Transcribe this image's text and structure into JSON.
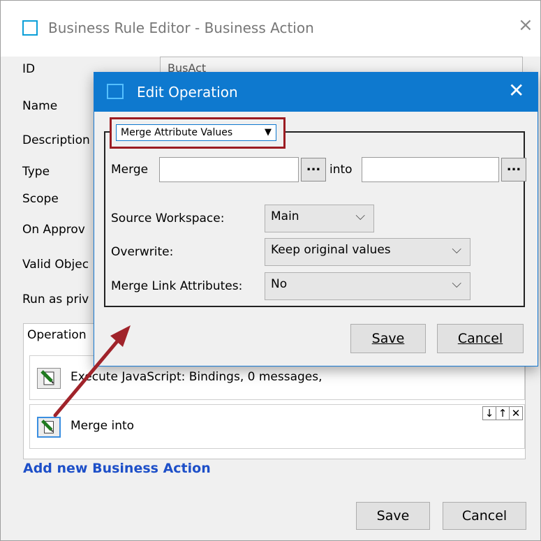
{
  "outer": {
    "title": "Business Rule Editor - Business Action",
    "close": "×",
    "labels": {
      "id": "ID",
      "name": "Name",
      "description": "Description",
      "type": "Type",
      "scope": "Scope",
      "on_approve": "On Approv",
      "valid_objects": "Valid Objec",
      "run_as": "Run as priv"
    },
    "id_value": "BusAct",
    "operations_header": "Operation",
    "operations": [
      {
        "text": "Execute JavaScript: Bindings, 0 messages,"
      },
      {
        "text": "Merge  into",
        "controls": [
          "↓",
          "↑",
          "✕"
        ]
      }
    ],
    "add_link": "Add new Business Action",
    "save": "Save",
    "cancel": "Cancel"
  },
  "dialog": {
    "title": "Edit Operation",
    "close": "✕",
    "operation_type": "Merge Attribute Values",
    "merge_label": "Merge",
    "into_label": "into",
    "dots": "...",
    "source_workspace": {
      "label": "Source Workspace:",
      "value": "Main"
    },
    "overwrite": {
      "label": "Overwrite:",
      "value": "Keep original values"
    },
    "merge_link_attributes": {
      "label": "Merge Link Attributes:",
      "value": "No"
    },
    "save": "Save",
    "cancel": "Cancel"
  },
  "colors": {
    "dialog_title_bg": "#0e79cf",
    "highlight_box": "#9b1c22",
    "annotation_arrow": "#a0232a",
    "link": "#1d4fc8"
  }
}
